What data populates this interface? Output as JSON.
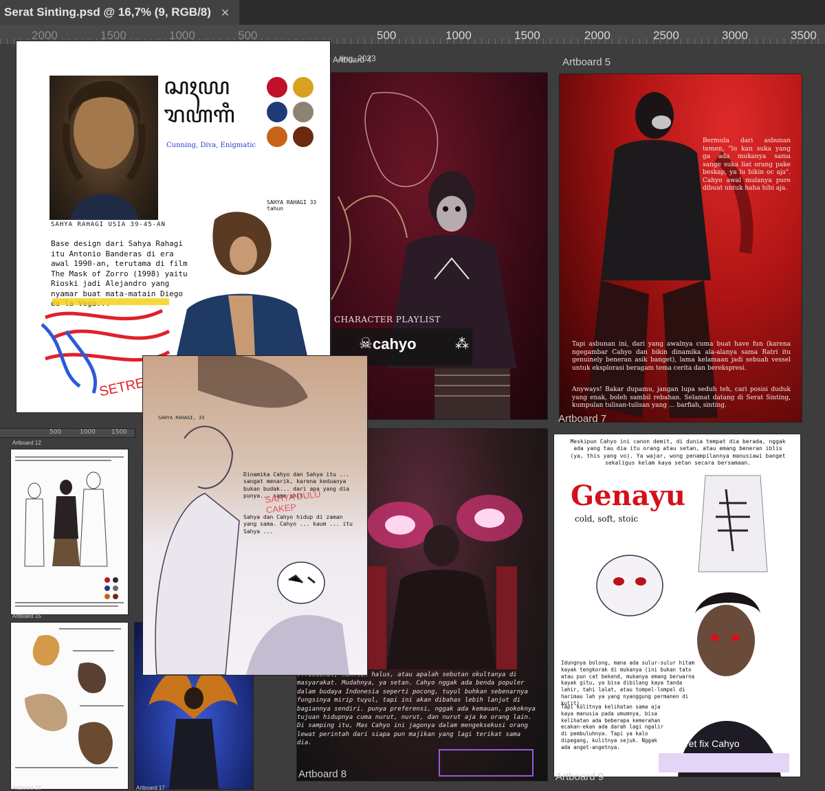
{
  "window": {
    "tab_title": "Serat Sinting.psd @ 16,7% (9, RGB/8)",
    "close_glyph": "✕"
  },
  "ruler": {
    "labels": [
      "2000",
      "1500",
      "1000",
      "500",
      "500",
      "1000",
      "1500",
      "2000",
      "2500",
      "3000",
      "3500"
    ]
  },
  "artboards": {
    "ab4": {
      "label": "Artboard 4",
      "partial_title": "...ting, 2023",
      "playlist_heading": "CHARACTER PLAYLIST",
      "playlist_name": "cahyo"
    },
    "ab5": {
      "label": "Artboard 5",
      "paragraph_top": "Bermula dari asbunan temen, \"lu kan suka yang ga ada mukanya sama sange suka liat orang pake beskap, ya lu bikin oc aja\". Cahyo awal mulanya pure dibuat untuk haha hihi aja.",
      "paragraph_bottom": "Tapi asbunan ini, dari yang awalnya cuma buat have fun (karena ngegambar Cahyo dan bikin dinamika ala-alanya sama Ratri itu genuinely beneran asik banget), lama kelamaan jadi sebuah vessel untuk eksplorasi beragam tema cerita dan berekspresi.",
      "paragraph_end": "Anyways! Bakar dupamu, jangan lupa seduh teh, cari posisi duduk yang enak, boleh sambil rebahan. Selamat datang di Serat Sinting, kumpulan tulisan-tulisan yang ... barfiah, sinting."
    },
    "ab7": {
      "label": "Artboard 7"
    },
    "ab8": {
      "label": "Artboard 8",
      "paragraph": "...dedemit, makhluk halus, atau apalah sebutan okultanya di masyarakat. Mudahnya, ya setan. Cahyo nggak ada benda populer dalam budaya Indonesia seperti pocong, tuyul buhkan sebenarnya fungsinya mirip tuyul, tapi ini akan dibahas lebih lanjut di bagiannya sendiri. punya preferensi, nggak ada kemauan, pokoknya tujuan hidupnya cuma nurut, nurut, dan nurut aja ke orang lain. Di samping itu, Mas Cahyo ini jagonya dalam mengeksekusi orang lewat perintah dari siapa pun majikan yang lagi terikat sama dia."
    },
    "ab9": {
      "label": "Artboard 9",
      "intro": "Meskipun Cahyo ini canon demit, di dunia tempat dia berada, nggak ada yang tau dia itu orang atau setan, atau emang beneran iblis (ya, this yang vo). Ya wajar, wong penampilannya manusiawi banget sekaligus kelam kaya setan secara bersamaan.",
      "title": "Genayu",
      "subtitle": "cold, soft, stoic",
      "body": "Idungnya bolong, mana ada sulur-sulur hitam kayak tengkorak di mukanya (ini bukan tato atau pun cat bekend, mukanya emang berwarna kayak gitu, ya bisa dibilang kaya tanda lahir, tahi lalat, atau tompel-lompel di harimau lah ya yang nyanggung permanen di kulit).",
      "body2": "Tapi kulitnya kelihatan sama aja kaya manusia pada umumnya, bisa kelihatan ada beberapa kemerahan ecakan-ekan ada darah lagi ngalir di pembuluhnya. Tapi ya kalo dipegang, kulitnya sejuk. Nggak ada anget-angetnya.",
      "caption": "Potret fix Cahyo"
    },
    "sahya": {
      "javanese_line1": "ꦱꦃꦪ",
      "javanese_line2": "ꦫꦲꦒꦶ",
      "traits": "Cunning, Diva, Enigmatic",
      "portrait_caption": "SAHYA RAHAGI USIA 39-45-AN",
      "sketch_caption": "SAHYA RAHAGI 33 tahun",
      "body": "Base design dari Sahya Rahagi itu Antonio Banderas di era awal 1990-an, terutama di film The Mask of Zorro (1998) yaitu Rioski jadi Alejandro yang nyamar buat mata-matain Diego de la Vega...",
      "scribble": "SETREEA",
      "swatches": [
        "#c0102a",
        "#d9a11e",
        "#1f3a78",
        "#8c8373",
        "#c8641a",
        "#6b2a10"
      ]
    },
    "overlay": {
      "caption": "SAHYA RAHAGI, 33",
      "dialog_1": "Dinamika Cahyo dan Sahya itu ... sangat menarik, karena keduanya bukan budak... dari apa yang dia punya... same shit.",
      "dialog_2": "Sahya dan Cahyo hidup di zaman yang sama. Cahyo ... kaum ... itu Sahya ...",
      "handwriting": "SAHYA DULU CAKEP"
    },
    "ab12": {
      "label": "Artboard 12",
      "ruler": [
        "500",
        "1000",
        "1500"
      ]
    },
    "ab15": {
      "label": "Artboard 15"
    },
    "ab16": {
      "label": "Artboard 16"
    },
    "ab17": {
      "label": "Artboard 17"
    }
  },
  "colors": {
    "canvas": "#3d3d3d",
    "ab5_red": "#d01818",
    "genayu_red": "#d4111a",
    "accent_purple": "#7b3ff2"
  }
}
